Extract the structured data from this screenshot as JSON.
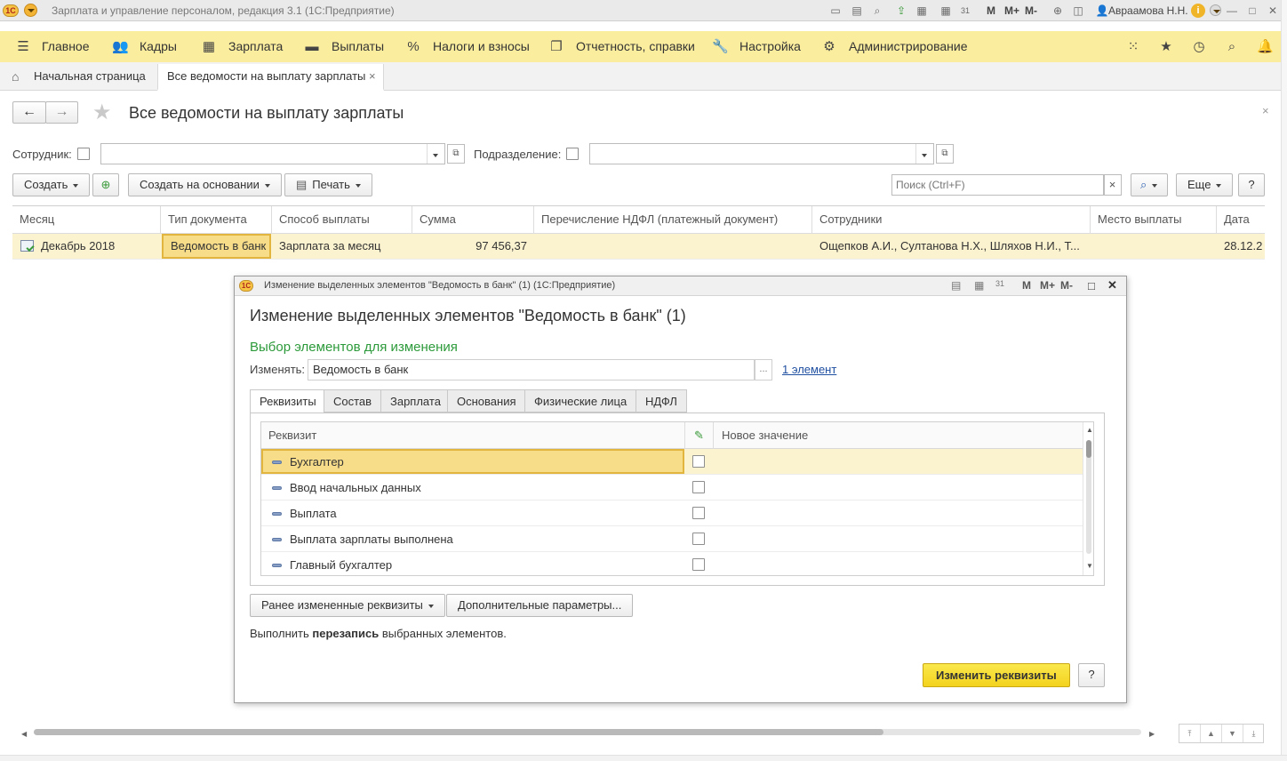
{
  "window": {
    "logo": "1С",
    "title": "Зарплата и управление персоналом, редакция 3.1  (1С:Предприятие)",
    "m_labels": [
      "M",
      "M+",
      "M-"
    ],
    "user": "Авраамова Н.Н.",
    "window_buttons": [
      "—",
      "□",
      "✕"
    ]
  },
  "menu": {
    "items": [
      {
        "label": "Главное",
        "icon": "hamburger-icon"
      },
      {
        "label": "Кадры",
        "icon": "people-icon"
      },
      {
        "label": "Зарплата",
        "icon": "calculator-icon"
      },
      {
        "label": "Выплаты",
        "icon": "wallet-icon"
      },
      {
        "label": "Налоги и взносы",
        "icon": "percent-icon"
      },
      {
        "label": "Отчетность, справки",
        "icon": "documents-icon"
      },
      {
        "label": "Настройка",
        "icon": "wrench-icon"
      },
      {
        "label": "Администрирование",
        "icon": "gear-icon"
      }
    ]
  },
  "tabs": [
    {
      "label": "Начальная страница"
    },
    {
      "label": "Все ведомости на выплату зарплаты",
      "close": "×"
    }
  ],
  "page": {
    "title": "Все ведомости на выплату зарплаты",
    "filters": {
      "employee_label": "Сотрудник:",
      "department_label": "Подразделение:"
    },
    "toolbar": {
      "create": "Создать",
      "create_based_on": "Создать на основании",
      "print": "Печать",
      "search_placeholder": "Поиск (Ctrl+F)",
      "clear": "×",
      "more": "Еще",
      "help": "?"
    },
    "table": {
      "columns": [
        "Месяц",
        "Тип документа",
        "Способ выплаты",
        "Сумма",
        "Перечисление НДФЛ (платежный документ)",
        "Сотрудники",
        "Место выплаты",
        "Дата"
      ],
      "rows": [
        {
          "month": "Декабрь 2018",
          "doc_type": "Ведомость в банк",
          "payment_method": "Зарплата за месяц",
          "sum": "97 456,37",
          "ndfl": "",
          "employees": "Ощепков А.И., Султанова Н.Х., Шляхов Н.И., Т...",
          "place": "",
          "date": "28.12.2"
        }
      ]
    }
  },
  "dialog": {
    "window_title": "Изменение выделенных элементов \"Ведомость в банк\" (1)  (1С:Предприятие)",
    "heading": "Изменение выделенных элементов \"Ведомость в банк\" (1)",
    "section": "Выбор элементов для изменения",
    "change_label": "Изменять:",
    "change_value": "Ведомость в банк",
    "ellipsis": "...",
    "count_link": "1 элемент",
    "tabs": [
      "Реквизиты",
      "Состав",
      "Зарплата",
      "Основания",
      "Физические лица",
      "НДФЛ"
    ],
    "grid": {
      "col_attr": "Реквизит",
      "col_new": "Новое значение",
      "rows": [
        "Бухгалтер",
        "Ввод начальных данных",
        "Выплата",
        "Выплата зарплаты выполнена",
        "Главный бухгалтер"
      ]
    },
    "prev_changed": "Ранее измененные реквизиты",
    "extra_params": "Дополнительные параметры...",
    "note_prefix": "Выполнить ",
    "note_bold": "перезапись",
    "note_suffix": " выбранных элементов.",
    "apply": "Изменить реквизиты",
    "help": "?"
  },
  "colors": {
    "menu_bg": "#fbed9e",
    "highlight_row": "#fbf2cf",
    "selected_cell": "#f7dd8a",
    "section_green": "#2c9a3a",
    "link_blue": "#1f4fa0",
    "primary_button": "#f8dd32"
  }
}
